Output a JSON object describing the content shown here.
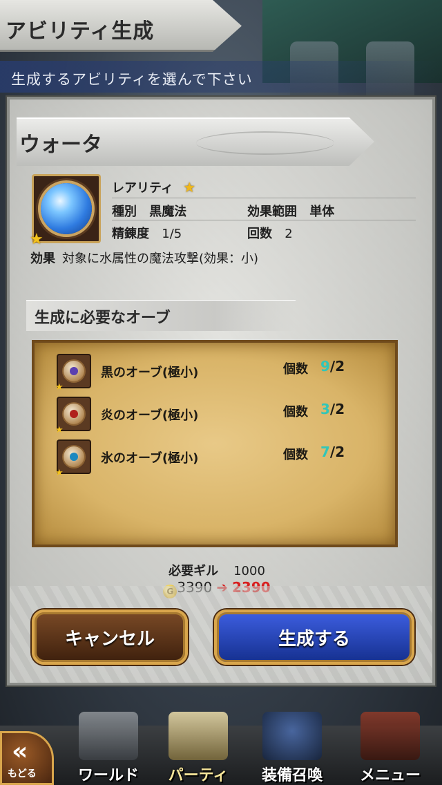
{
  "header": {
    "title": "アビリティ生成",
    "subtitle": "生成するアビリティを選んで下さい"
  },
  "ability": {
    "name": "ウォータ",
    "rarity_label": "レアリティ",
    "rarity_star": "★",
    "type_label": "種別",
    "type_value": "黒魔法",
    "range_label": "効果範囲",
    "range_value": "単体",
    "refine_label": "精錬度",
    "refine_value": "1/5",
    "uses_label": "回数",
    "uses_value": "2",
    "effect_label": "効果",
    "effect_value": "対象に水属性の魔法攻撃(効果：小)",
    "icon": "water-orb-icon"
  },
  "required_orbs": {
    "title": "生成に必要なオーブ",
    "count_label": "個数",
    "items": [
      {
        "name": "黒のオーブ(極小)",
        "have": "9",
        "need": "/2",
        "icon": "black-orb-icon",
        "core_color": "#5a3fb0"
      },
      {
        "name": "炎のオーブ(極小)",
        "have": "3",
        "need": "/2",
        "icon": "fire-orb-icon",
        "core_color": "#b0201c"
      },
      {
        "name": "氷のオーブ(極小)",
        "have": "7",
        "need": "/2",
        "icon": "ice-orb-icon",
        "core_color": "#1c88c0"
      }
    ]
  },
  "gil": {
    "label": "必要ギル",
    "cost": "1000",
    "coin_glyph": "G",
    "current": "3390",
    "arrow": "➔",
    "after": "2390"
  },
  "buttons": {
    "cancel": "キャンセル",
    "create": "生成する"
  },
  "nav": {
    "back_chevron": "«",
    "back_label": "もどる",
    "items": [
      {
        "label": "ワールド",
        "icon": "world-icon"
      },
      {
        "label": "パーティ",
        "icon": "party-chess-icon"
      },
      {
        "label": "装備召喚",
        "icon": "summon-icon"
      },
      {
        "label": "メニュー",
        "icon": "menu-book-icon"
      }
    ]
  },
  "colors": {
    "have_count": "#32c6b8",
    "gil_after": "#d81f1f",
    "button_gold": "#d9a64c"
  }
}
